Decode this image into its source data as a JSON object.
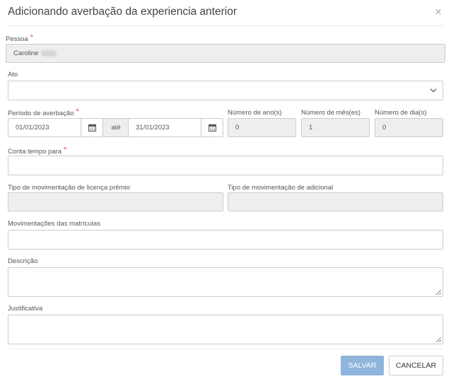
{
  "modal": {
    "title": "Adicionando averbação da experiencia anterior",
    "close_glyph": "×"
  },
  "form": {
    "pessoa": {
      "label": "Pessoa",
      "required": "*",
      "value": "Caroline"
    },
    "ato": {
      "label": "Ato",
      "value": ""
    },
    "periodo": {
      "label": "Período de averbação",
      "required": "*",
      "start": "01/01/2023",
      "separator": "até",
      "end": "31/01/2023"
    },
    "anos": {
      "label": "Número de ano(s)",
      "value": "0"
    },
    "meses": {
      "label": "Número de mês(es)",
      "value": "1"
    },
    "dias": {
      "label": "Número de dia(s)",
      "value": "0"
    },
    "conta_tempo": {
      "label": "Conta tempo para",
      "required": "*",
      "value": ""
    },
    "licenca_premio": {
      "label": "Tipo de movimentação de licença prêmio",
      "value": ""
    },
    "adicional": {
      "label": "Tipo de movimentação de adicional",
      "value": ""
    },
    "matriculas": {
      "label": "Movimentações das matrículas",
      "value": ""
    },
    "descricao": {
      "label": "Descrição",
      "value": ""
    },
    "justificativa": {
      "label": "Justificativa",
      "value": ""
    }
  },
  "footer": {
    "save_label": "SALVAR",
    "cancel_label": "CANCELAR"
  },
  "colors": {
    "primary_button": "#8fb5dc",
    "required_marker": "#d9534f",
    "disabled_field": "#eeeeee",
    "border": "#cccccc"
  },
  "icons": {
    "close": "close-icon",
    "select": "chevron-down-icon",
    "calendar": "calendar-icon",
    "resize": "resize-handle-icon"
  }
}
